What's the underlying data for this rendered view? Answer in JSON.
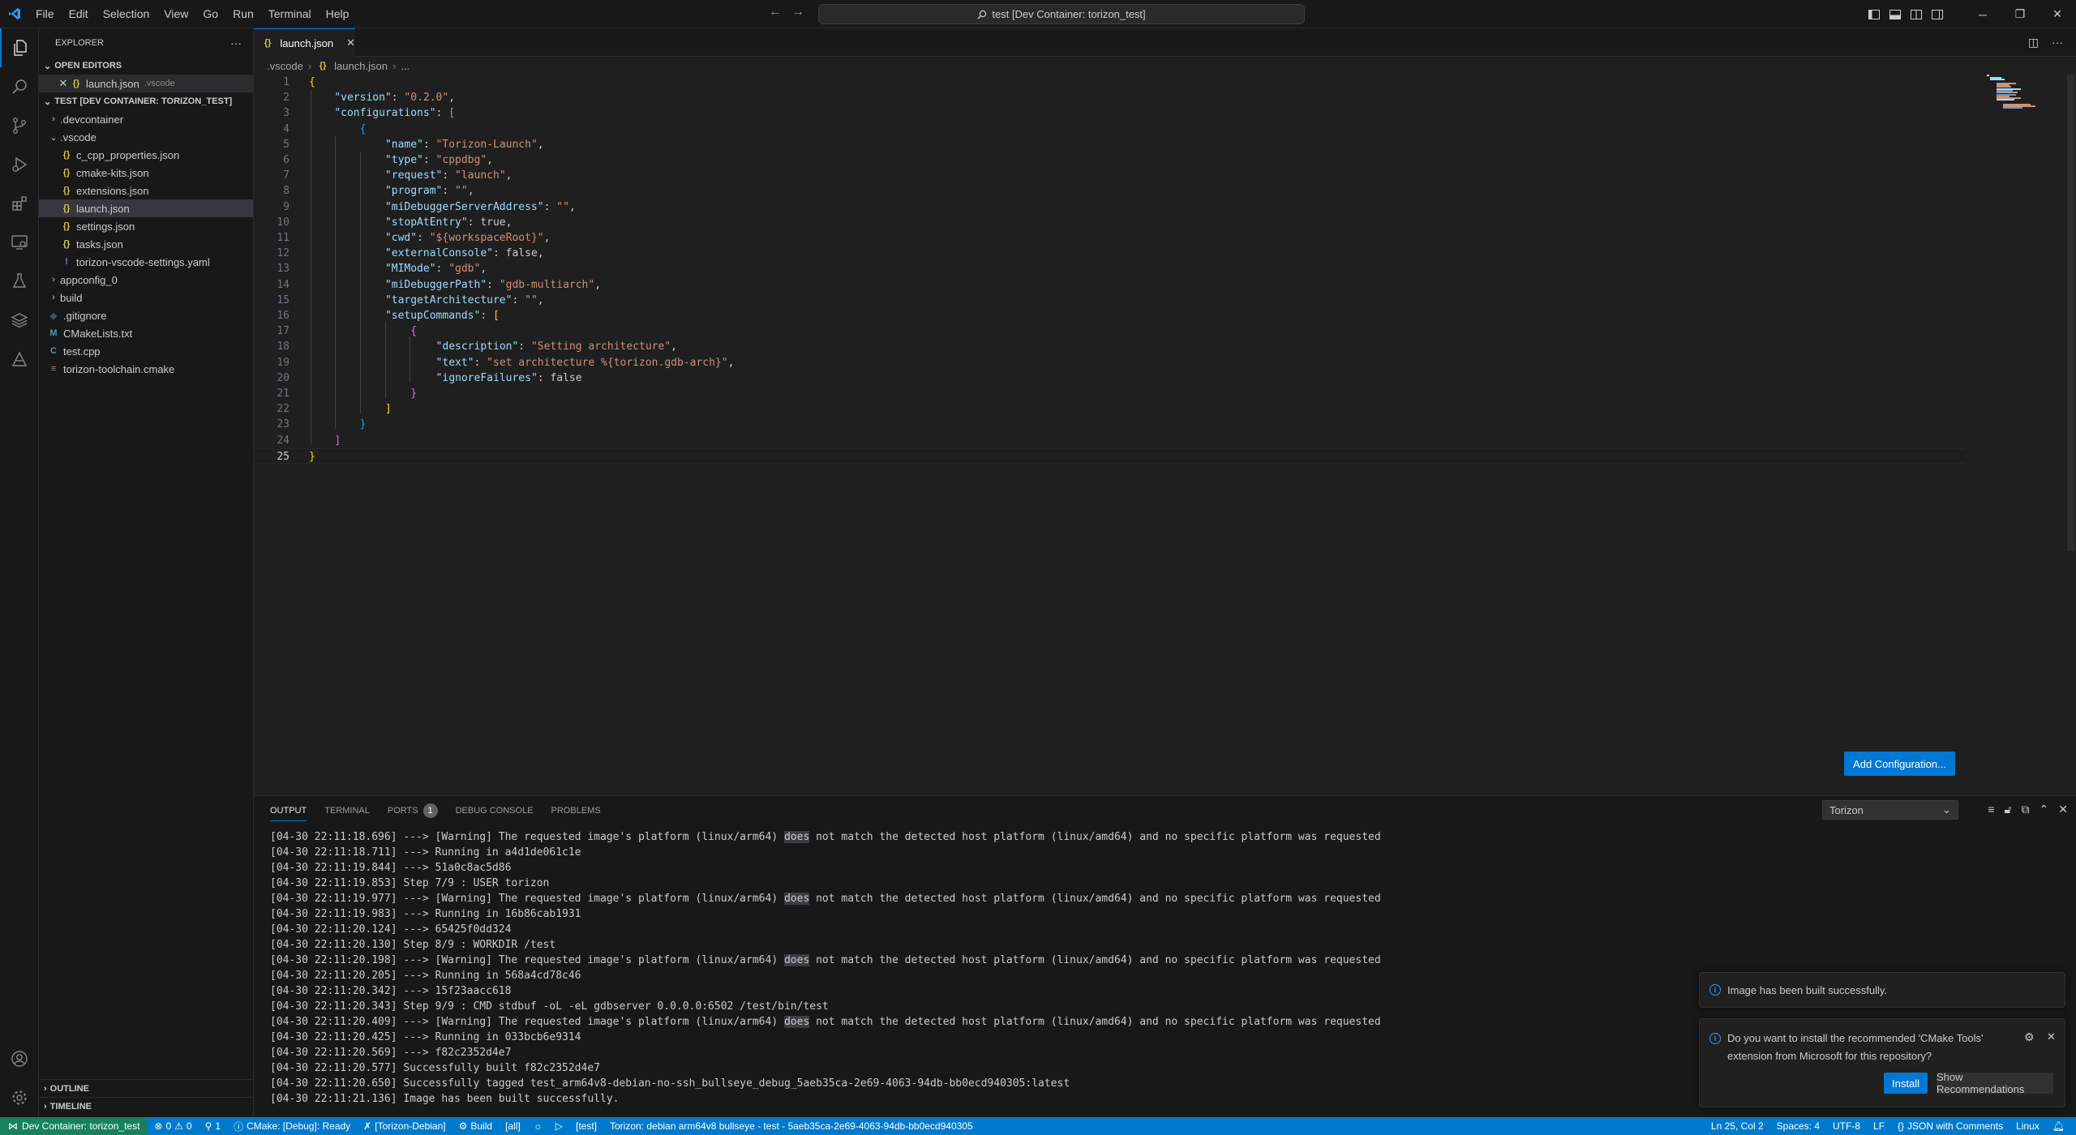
{
  "titlebar": {
    "menu": [
      "File",
      "Edit",
      "Selection",
      "View",
      "Go",
      "Run",
      "Terminal",
      "Help"
    ],
    "search": "test [Dev Container: torizon_test]"
  },
  "sidebar": {
    "title": "EXPLORER",
    "open_editors_label": "OPEN EDITORS",
    "open_editor": {
      "name": "launch.json",
      "desc": ".vscode"
    },
    "workspace_label": "TEST [DEV CONTAINER: TORIZON_TEST]",
    "tree": [
      {
        "name": ".devcontainer",
        "type": "folder",
        "open": false,
        "depth": 0
      },
      {
        "name": ".vscode",
        "type": "folder",
        "open": true,
        "depth": 0
      },
      {
        "name": "c_cpp_properties.json",
        "type": "json",
        "depth": 1
      },
      {
        "name": "cmake-kits.json",
        "type": "json",
        "depth": 1
      },
      {
        "name": "extensions.json",
        "type": "json",
        "depth": 1
      },
      {
        "name": "launch.json",
        "type": "json",
        "depth": 1,
        "selected": true
      },
      {
        "name": "settings.json",
        "type": "json",
        "depth": 1
      },
      {
        "name": "tasks.json",
        "type": "json",
        "depth": 1
      },
      {
        "name": "torizon-vscode-settings.yaml",
        "type": "yaml",
        "depth": 1
      },
      {
        "name": "appconfig_0",
        "type": "folder",
        "open": false,
        "depth": 0
      },
      {
        "name": "build",
        "type": "folder",
        "open": false,
        "depth": 0
      },
      {
        "name": ".gitignore",
        "type": "git",
        "depth": 0
      },
      {
        "name": "CMakeLists.txt",
        "type": "cmake",
        "depth": 0
      },
      {
        "name": "test.cpp",
        "type": "cpp",
        "depth": 0
      },
      {
        "name": "torizon-toolchain.cmake",
        "type": "tc",
        "depth": 0
      }
    ],
    "outline_label": "OUTLINE",
    "timeline_label": "TIMELINE"
  },
  "editor": {
    "tab_label": "launch.json",
    "breadcrumb": [
      ".vscode",
      "launch.json",
      "..."
    ],
    "code_lines": [
      "{",
      "    \"version\": \"0.2.0\",",
      "    \"configurations\": [",
      "        {",
      "            \"name\": \"Torizon-Launch\",",
      "            \"type\": \"cppdbg\",",
      "            \"request\": \"launch\",",
      "            \"program\": \"\",",
      "            \"miDebuggerServerAddress\": \"\",",
      "            \"stopAtEntry\": true,",
      "            \"cwd\": \"${workspaceRoot}\",",
      "            \"externalConsole\": false,",
      "            \"MIMode\": \"gdb\",",
      "            \"miDebuggerPath\": \"gdb-multiarch\",",
      "            \"targetArchitecture\": \"\",",
      "            \"setupCommands\": [",
      "                {",
      "                    \"description\": \"Setting architecture\",",
      "                    \"text\": \"set architecture %{torizon.gdb-arch}\",",
      "                    \"ignoreFailures\": false",
      "                }",
      "            ]",
      "        }",
      "    ]",
      "}"
    ],
    "add_config_label": "Add Configuration..."
  },
  "panel": {
    "tabs": [
      "OUTPUT",
      "TERMINAL",
      "PORTS",
      "DEBUG CONSOLE",
      "PROBLEMS"
    ],
    "ports_count": "1",
    "channel": "Torizon",
    "output_lines": [
      "[04-30 22:11:18.696] ---> [Warning] The requested image's platform (linux/arm64) does not match the detected host platform (linux/amd64) and no specific platform was requested",
      "[04-30 22:11:18.711] ---> Running in a4d1de061c1e",
      "[04-30 22:11:19.844] ---> 51a0c8ac5d86",
      "[04-30 22:11:19.853] Step 7/9 : USER torizon",
      "[04-30 22:11:19.977] ---> [Warning] The requested image's platform (linux/arm64) does not match the detected host platform (linux/amd64) and no specific platform was requested",
      "[04-30 22:11:19.983] ---> Running in 16b86cab1931",
      "[04-30 22:11:20.124] ---> 65425f0dd324",
      "[04-30 22:11:20.130] Step 8/9 : WORKDIR /test",
      "[04-30 22:11:20.198] ---> [Warning] The requested image's platform (linux/arm64) does not match the detected host platform (linux/amd64) and no specific platform was requested",
      "[04-30 22:11:20.205] ---> Running in 568a4cd78c46",
      "[04-30 22:11:20.342] ---> 15f23aacc618",
      "[04-30 22:11:20.343] Step 9/9 : CMD stdbuf -oL -eL gdbserver 0.0.0.0:6502 /test/bin/test",
      "[04-30 22:11:20.409] ---> [Warning] The requested image's platform (linux/arm64) does not match the detected host platform (linux/amd64) and no specific platform was requested",
      "[04-30 22:11:20.425] ---> Running in 033bcb6e9314",
      "[04-30 22:11:20.569] ---> f82c2352d4e7",
      "[04-30 22:11:20.577] Successfully built f82c2352d4e7",
      "[04-30 22:11:20.650] Successfully tagged test_arm64v8-debian-no-ssh_bullseye_debug_5aeb35ca-2e69-4063-94db-bb0ecd940305:latest",
      "[04-30 22:11:21.136] Image has been built successfully."
    ]
  },
  "notifications": {
    "built": "Image has been built successfully.",
    "cmake_prompt": "Do you want to install the recommended 'CMake Tools' extension from Microsoft for this repository?",
    "install_label": "Install",
    "recs_label": "Show Recommendations"
  },
  "statusbar": {
    "remote": "Dev Container: torizon_test",
    "errors": "0",
    "warnings": "0",
    "ports": "1",
    "cmake": "CMake: [Debug]: Ready",
    "kit": "[Torizon-Debian]",
    "build": "Build",
    "target": "[all]",
    "project": "[test]",
    "torizon": "Torizon: debian arm64v8 bullseye - test - 5aeb35ca-2e69-4063-94db-bb0ecd940305",
    "position": "Ln 25, Col 2",
    "spaces": "Spaces: 4",
    "encoding": "UTF-8",
    "eol": "LF",
    "language": "JSON with Comments",
    "os": "Linux"
  },
  "colors": {
    "accent": "#0078d4",
    "statusbar": "#007acc",
    "remote": "#16825d"
  }
}
